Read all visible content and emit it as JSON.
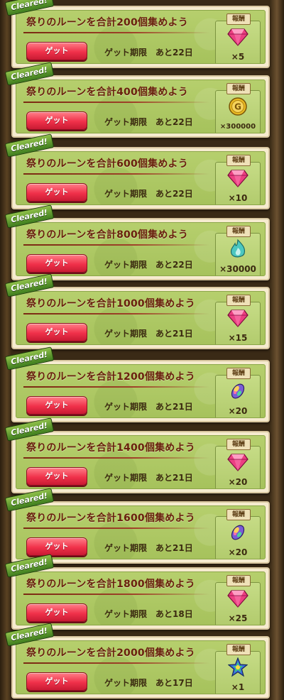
{
  "cleared_label": "Cleared!",
  "get_label": "ゲット",
  "reward_label": "報酬",
  "missions": [
    {
      "title": "祭りのルーンを合計200個集めよう",
      "deadline": "ゲット期限　あと22日",
      "reward_icon": "gem-icon",
      "reward_qty": "×5"
    },
    {
      "title": "祭りのルーンを合計400個集めよう",
      "deadline": "ゲット期限　あと22日",
      "reward_icon": "gold-coin-icon",
      "reward_qty": "×300000"
    },
    {
      "title": "祭りのルーンを合計600個集めよう",
      "deadline": "ゲット期限　あと22日",
      "reward_icon": "gem-icon",
      "reward_qty": "×10"
    },
    {
      "title": "祭りのルーンを合計800個集めよう",
      "deadline": "ゲット期限　あと22日",
      "reward_icon": "teal-flame-icon",
      "reward_qty": "×30000"
    },
    {
      "title": "祭りのルーンを合計1000個集めよう",
      "deadline": "ゲット期限　あと21日",
      "reward_icon": "gem-icon",
      "reward_qty": "×15"
    },
    {
      "title": "祭りのルーンを合計1200個集めよう",
      "deadline": "ゲット期限　あと21日",
      "reward_icon": "rainbow-seed-icon",
      "reward_qty": "×20"
    },
    {
      "title": "祭りのルーンを合計1400個集めよう",
      "deadline": "ゲット期限　あと21日",
      "reward_icon": "gem-icon",
      "reward_qty": "×20"
    },
    {
      "title": "祭りのルーンを合計1600個集めよう",
      "deadline": "ゲット期限　あと21日",
      "reward_icon": "rainbow-seed-icon",
      "reward_qty": "×20"
    },
    {
      "title": "祭りのルーンを合計1800個集めよう",
      "deadline": "ゲット期限　あと18日",
      "reward_icon": "gem-icon",
      "reward_qty": "×25"
    },
    {
      "title": "祭りのルーンを合計2000個集めよう",
      "deadline": "ゲット期限　あと17日",
      "reward_icon": "star-icon",
      "reward_qty": "×1"
    }
  ]
}
